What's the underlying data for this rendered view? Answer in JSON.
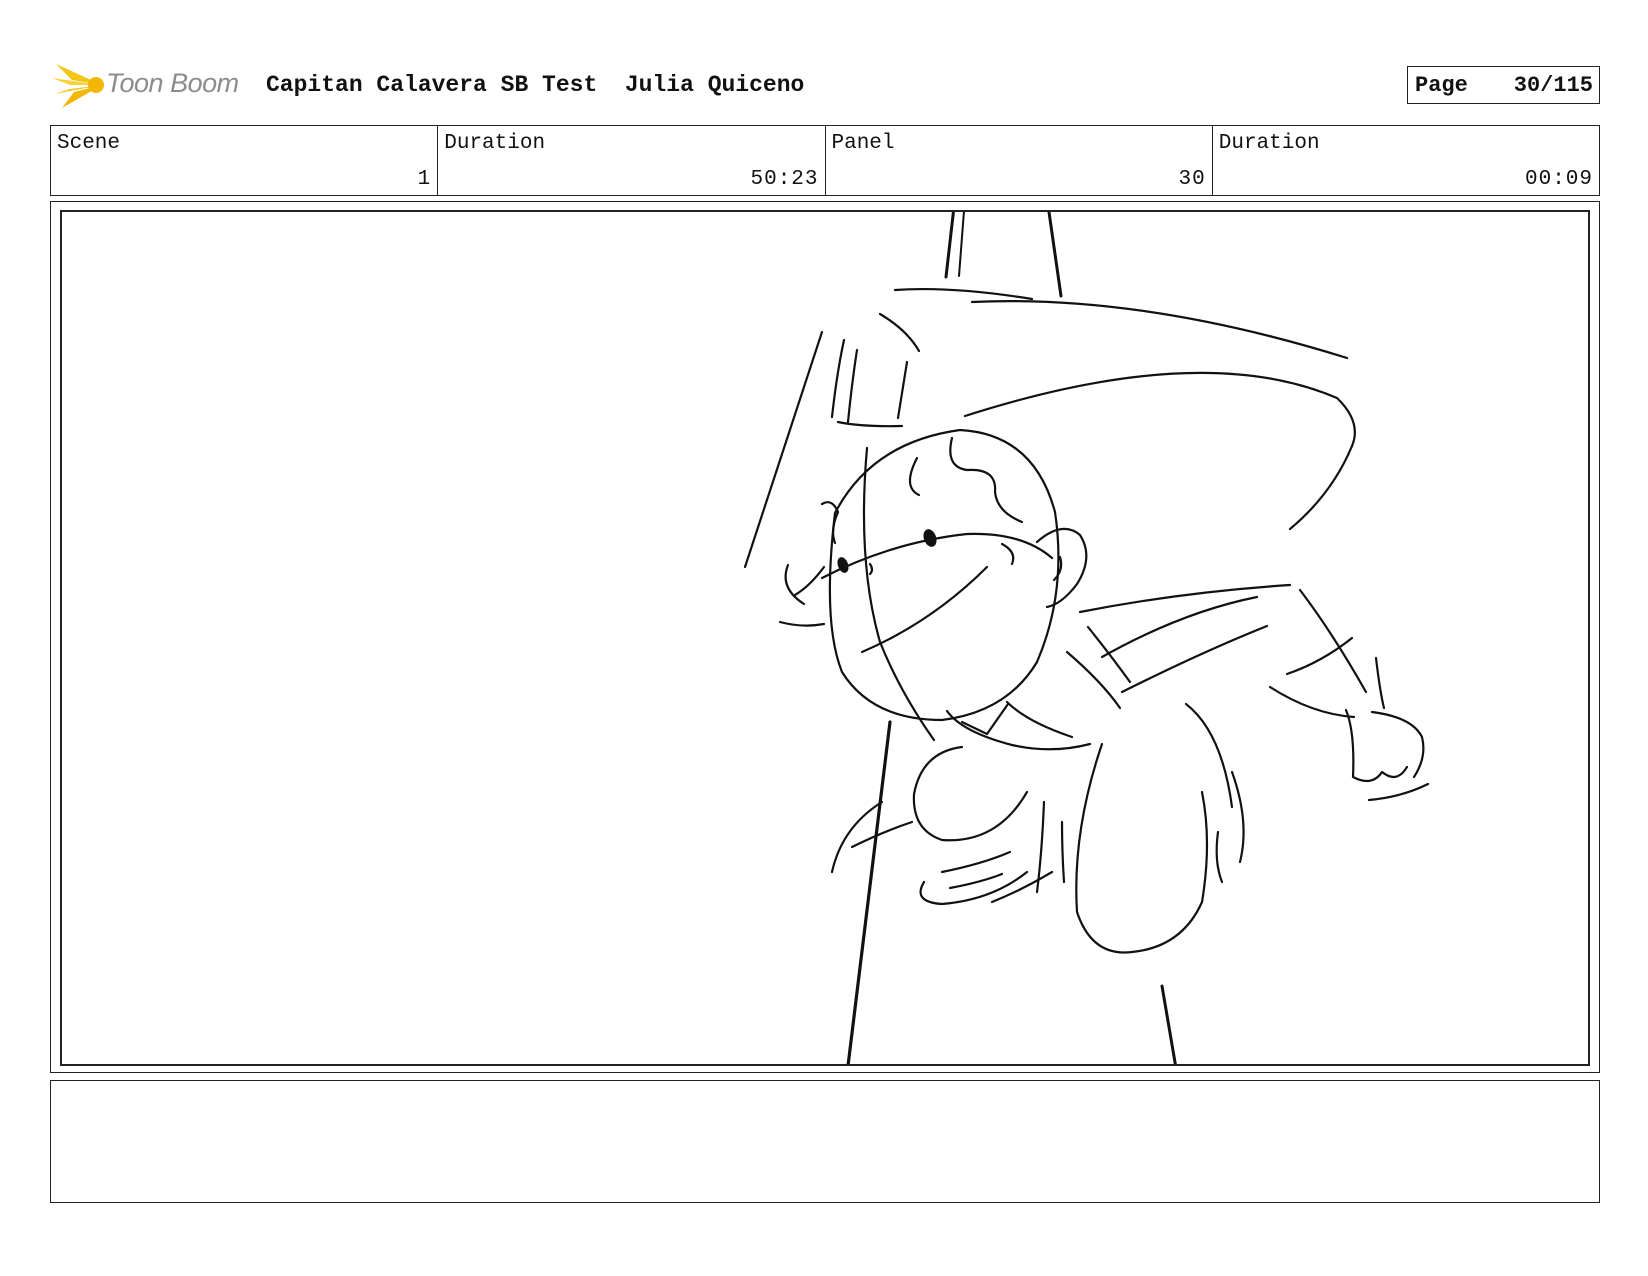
{
  "header": {
    "logo_text": "Toon Boom",
    "project_title": "Capitan Calavera SB Test",
    "author": "Julia Quiceno",
    "page_label": "Page",
    "page_value": "30/115"
  },
  "info": {
    "scene_label": "Scene",
    "scene_value": "1",
    "scene_duration_label": "Duration",
    "scene_duration_value": "50:23",
    "panel_label": "Panel",
    "panel_value": "30",
    "panel_duration_label": "Duration",
    "panel_duration_value": "00:09"
  },
  "colors": {
    "logo_yellow": "#f5c518",
    "logo_text": "#8c8c8c",
    "line": "#111111"
  }
}
